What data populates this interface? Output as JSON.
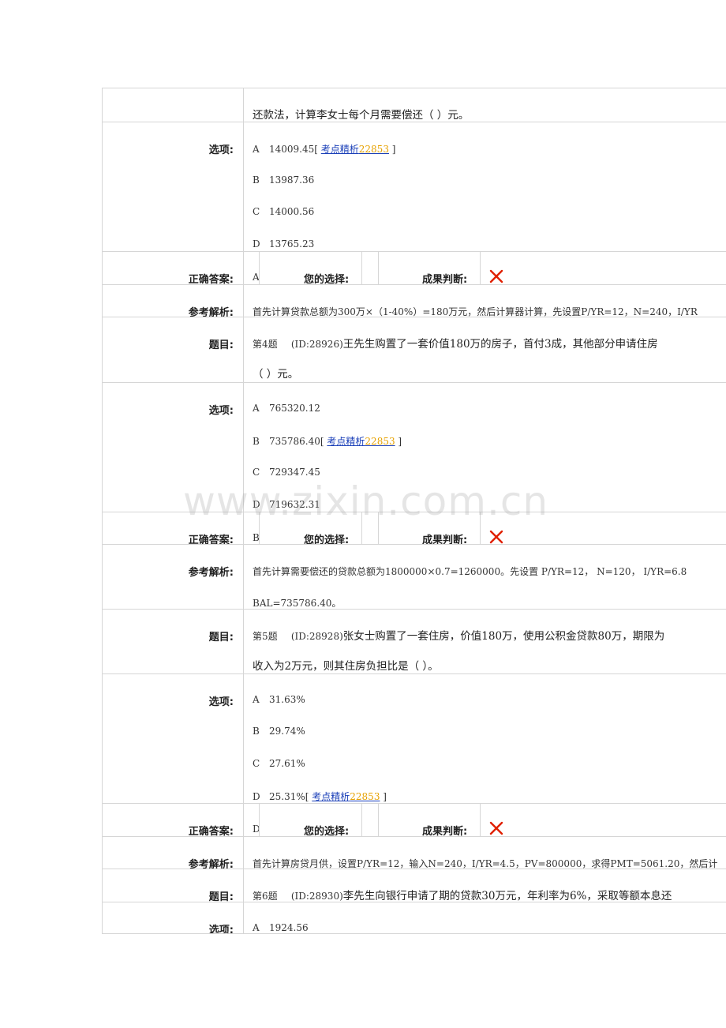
{
  "labels": {
    "options": "选项:",
    "correct_answer": "正确答案:",
    "your_choice": "您的选择:",
    "result": "成果判断:",
    "analysis": "参考解析:",
    "question": "题目:"
  },
  "link_text": "考点精析",
  "link_num": "22853",
  "q3": {
    "text_cont": "还款法，计算李女士每个月需要偿还（  ）元。",
    "options": [
      {
        "key": "A",
        "value": "14009.45"
      },
      {
        "key": "B",
        "value": "13987.36"
      },
      {
        "key": "C",
        "value": "14000.56"
      },
      {
        "key": "D",
        "value": "13765.23"
      }
    ],
    "answer": "A",
    "analysis": "首先计算贷款总额为300万×（1-40%）=180万元，然后计算器计算，先设置P/YR=12，N=240，I/YR"
  },
  "q4": {
    "number": "第4题",
    "id": "(ID:28926)",
    "text_line1": "王先生购置了一套价值180万的房子，首付3成，其他部分申请住房",
    "text_line2": "（  ）元。",
    "options": [
      {
        "key": "A",
        "value": "765320.12"
      },
      {
        "key": "B",
        "value": "735786.40"
      },
      {
        "key": "C",
        "value": "729347.45"
      },
      {
        "key": "D",
        "value": "719632.31"
      }
    ],
    "answer": "B",
    "analysis_line1": "首先计算需要偿还的贷款总额为1800000×0.7=1260000。先设置 P/YR=12， N=120， I/YR=6.8",
    "analysis_line2": "BAL=735786.40。"
  },
  "q5": {
    "number": "第5题",
    "id": "(ID:28928)",
    "text_line1": "张女士购置了一套住房，价值180万，使用公积金贷款80万，期限为",
    "text_line2": "收入为2万元，则其住房负担比是（  ）。",
    "options": [
      {
        "key": "A",
        "value": "31.63%"
      },
      {
        "key": "B",
        "value": "29.74%"
      },
      {
        "key": "C",
        "value": "27.61%"
      },
      {
        "key": "D",
        "value": "25.31%"
      }
    ],
    "answer": "D",
    "analysis": "首先计算房贷月供，设置P/YR=12，输入N=240，I/YR=4.5，PV=800000，求得PMT=5061.20，然后计"
  },
  "q6": {
    "number": "第6题",
    "id": "(ID:28930)",
    "text_line1": "李先生向银行申请了期的贷款30万元，年利率为6%，采取等额本息还",
    "options": [
      {
        "key": "A",
        "value": "1924.56"
      }
    ]
  },
  "watermark": "www.zixin.com.cn",
  "colors": {
    "border": "#d6d6d6",
    "link": "#1a3fb8",
    "link_num": "#e6a100",
    "wrong_mark": "#e02000"
  },
  "icons": {
    "result": "x-icon"
  }
}
